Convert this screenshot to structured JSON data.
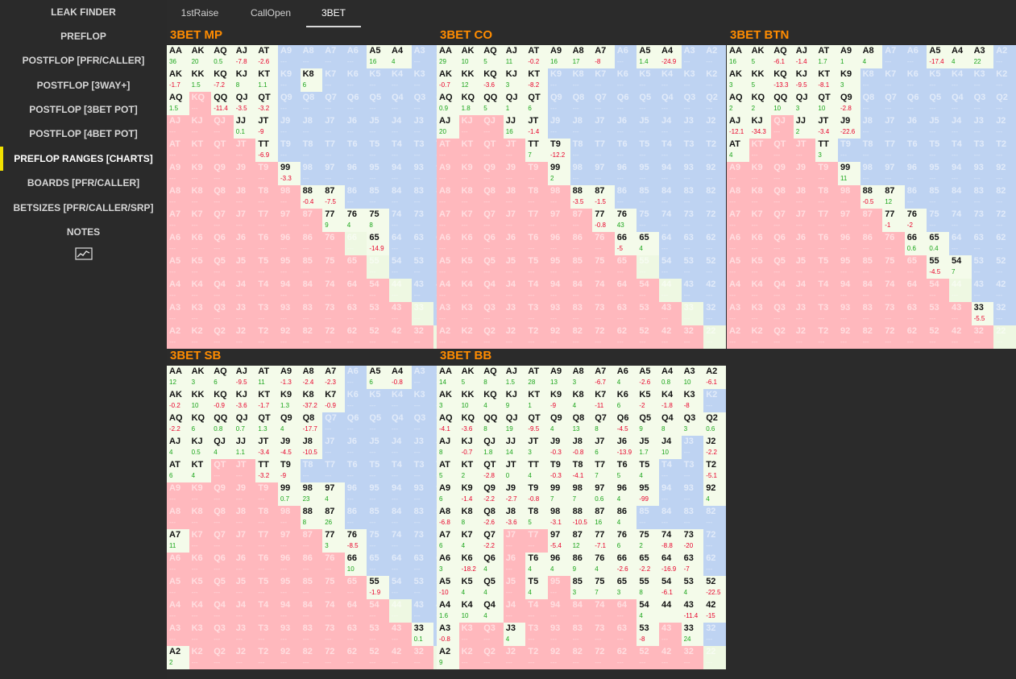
{
  "sidebar": {
    "items": [
      {
        "label": "LEAK FINDER",
        "name": "sidebar-item-leak-finder",
        "active": false
      },
      {
        "label": "PREFLOP",
        "name": "sidebar-item-preflop",
        "active": false
      },
      {
        "label": "POSTFLOP [PFR/CALLER]",
        "name": "sidebar-item-postflop-pfr-caller",
        "active": false
      },
      {
        "label": "POSTFLOP [3WAY+]",
        "name": "sidebar-item-postflop-3way",
        "active": false
      },
      {
        "label": "POSTFLOP [3BET POT]",
        "name": "sidebar-item-postflop-3bet-pot",
        "active": false
      },
      {
        "label": "POSTFLOP [4BET POT]",
        "name": "sidebar-item-postflop-4bet-pot",
        "active": false
      },
      {
        "label": "PREFLOP RANGES [CHARTS]",
        "name": "sidebar-item-preflop-ranges-charts",
        "active": true
      },
      {
        "label": "BOARDS [PFR/CALLER]",
        "name": "sidebar-item-boards-pfr-caller",
        "active": false
      },
      {
        "label": "BETSIZES [PFR/CALLER/SRP]",
        "name": "sidebar-item-betsizes",
        "active": false
      },
      {
        "label": "NOTES",
        "name": "sidebar-item-notes",
        "active": false
      }
    ],
    "chart_icon": "line-chart-icon"
  },
  "tabs": [
    {
      "label": "1stRaise",
      "active": false
    },
    {
      "label": "CallOpen",
      "active": false
    },
    {
      "label": "3BET",
      "active": true
    }
  ],
  "ranks": [
    "A",
    "K",
    "Q",
    "J",
    "T",
    "9",
    "8",
    "7",
    "6",
    "5",
    "4",
    "3",
    "2"
  ],
  "placeholder_value": "---",
  "colors": {
    "accent": "#ff8c00",
    "pair": "#eef8e2",
    "suited": "#bed3f2",
    "offsuit": "#ffb8bd",
    "active_cell": "#f4fbea",
    "positive": "#1aa51a",
    "negative": "#e8002a",
    "indicator": "#f0e000"
  },
  "panels": [
    {
      "title": "3BET MP",
      "cells": {
        "AA": "36",
        "AKs": "20",
        "AQs": "0.5",
        "AJs": "-7.8",
        "ATs": "-2.6",
        "A5s": "16",
        "A4s": "4",
        "AKo": "-1.7",
        "KK": "1.5",
        "KQs": "-7.2",
        "KJs": "8",
        "KTs": "1.1",
        "K8s": "6",
        "AQo": "1.5",
        "QQ": "-11.4",
        "QJs": "-3.5",
        "QTs": "-3.2",
        "JJ": "0.1",
        "JTs": "-9",
        "TT": "-6.9",
        "99": "-3.3",
        "88": "-0.4",
        "87s": "-7.5",
        "77": "9",
        "76s": "4",
        "75s": "8",
        "65s": "-14.9"
      }
    },
    {
      "title": "3BET CO",
      "cells": {
        "AA": "29",
        "AKs": "10",
        "AQs": "5",
        "AJs": "11",
        "ATs": "-0.2",
        "A9s": "16",
        "A8s": "17",
        "A7s": "-8",
        "A5s": "1.4",
        "A4s": "-24.9",
        "AKo": "-0.7",
        "KK": "12",
        "KQs": "-3.6",
        "KJs": "3",
        "KTs": "-8.2",
        "AQo": "0.9",
        "KQo": "1.8",
        "QQ": "5",
        "QJs": "1",
        "QTs": "6",
        "AJo": "20",
        "JJ": "16",
        "JTs": "-1.4",
        "TT": "7",
        "T9s": "-12.2",
        "99": "2",
        "88": "-3.5",
        "87s": "-1.5",
        "77": "-0.8",
        "76s": "43",
        "66": "-5",
        "65s": "4"
      }
    },
    {
      "title": "3BET BTN",
      "cells": {
        "AA": "16",
        "AKs": "5",
        "AQs": "-6.1",
        "AJs": "-1.4",
        "ATs": "1.7",
        "A9s": "1",
        "A8s": "4",
        "A5s": "-17.4",
        "A4s": "4",
        "A3s": "22",
        "AKo": "3",
        "KK": "5",
        "KQs": "-13.3",
        "KJs": "-9.5",
        "KTs": "-8.1",
        "K9s": "3",
        "AQo": "2",
        "KQo": "2",
        "QQ": "10",
        "QJs": "3",
        "QTs": "10",
        "Q9s": "-2.8",
        "AJo": "-12.1",
        "KJo": "-34.3",
        "JJ": "2",
        "JTs": "-3.4",
        "J9s": "-22.6",
        "ATo": "4",
        "TT": "3",
        "99": "11",
        "88": "-0.5",
        "87s": "12",
        "77": "-1",
        "76s": "-2",
        "66": "0.6",
        "65s": "0.4",
        "55": "-4.5",
        "54s": "7",
        "33": "-5.5"
      }
    },
    {
      "title": "3BET SB",
      "cells": {
        "AA": "12",
        "AKs": "3",
        "AQs": "6",
        "AJs": "-9.5",
        "ATs": "11",
        "A9s": "-1.3",
        "A8s": "-2.4",
        "A7s": "-2.3",
        "A5s": "6",
        "A4s": "-0.8",
        "AKo": "-0.2",
        "KK": "10",
        "KQs": "-0.9",
        "KJs": "-3.6",
        "KTs": "-1.7",
        "K9s": "1.3",
        "K8s": "-37.2",
        "K7s": "-0.9",
        "AQo": "-2.2",
        "KQo": "6",
        "QQ": "0.8",
        "QJs": "0.7",
        "QTs": "1.3",
        "Q9s": "4",
        "Q8s": "-17.7",
        "AJo": "4",
        "KJo": "0.5",
        "QJo": "4",
        "JJ": "1.1",
        "JTs": "-3.4",
        "J9s": "-4.5",
        "J8s": "-10.5",
        "ATo": "6",
        "KTo": "4",
        "TT": "-3.2",
        "T9s": "-9",
        "99": "0.7",
        "98s": "23",
        "97s": "4",
        "88": "8",
        "87s": "26",
        "A7o": "11",
        "77": "3",
        "76s": "-8.5",
        "66": "10",
        "55": "-1.9",
        "33": "0.1",
        "A2o": "2"
      }
    },
    {
      "title": "3BET BB",
      "cells": {
        "AA": "14",
        "AKs": "5",
        "AQs": "8",
        "AJs": "1.5",
        "ATs": "28",
        "A9s": "13",
        "A8s": "3",
        "A7s": "-6.7",
        "A6s": "4",
        "A5s": "-2.6",
        "A4s": "0.8",
        "A3s": "10",
        "A2s": "-6.1",
        "AKo": "3",
        "KK": "10",
        "KQs": "4",
        "KJs": "9",
        "KTs": "1",
        "K9s": "-9",
        "K8s": "4",
        "K7s": "-11",
        "K6s": "6",
        "K5s": "-2",
        "K4s": "-1.8",
        "K3s": "-8",
        "AQo": "-4.1",
        "KQo": "-3.6",
        "QQ": "8",
        "QJs": "19",
        "QTs": "-9.5",
        "Q9s": "4",
        "Q8s": "13",
        "Q7s": "8",
        "Q6s": "-4.5",
        "Q5s": "9",
        "Q4s": "8",
        "Q3s": "3",
        "Q2s": "0.6",
        "AJo": "8",
        "KJo": "-0.7",
        "QJo": "1.8",
        "JJ": "14",
        "JTs": "3",
        "J9s": "-0.3",
        "J8s": "-0.8",
        "J7s": "6",
        "J6s": "-13.9",
        "J5s": "1.7",
        "J4s": "10",
        "J2s": "-2.2",
        "ATo": "5",
        "KTo": "2",
        "QTo": "-2.8",
        "JTo": "0",
        "TT": "4",
        "T9s": "-0.3",
        "T8s": "-4.1",
        "T7s": "7",
        "T6s": "5",
        "T5s": "4",
        "T2s": "-5.1",
        "A9o": "6",
        "K9o": "-1.4",
        "Q9o": "-2.2",
        "J9o": "-2.7",
        "T9o": "-0.8",
        "99": "7",
        "98s": "7",
        "97s": "0.6",
        "96s": "4",
        "95s": "-99",
        "92s": "4",
        "A8o": "-6.8",
        "K8o": "8",
        "Q8o": "-2.6",
        "J8o": "-3.6",
        "T8o": "5",
        "98o": "-3.1",
        "88": "-10.5",
        "87s": "16",
        "86s": "4",
        "A7o": "6",
        "K7o": "4",
        "Q7o": "-2.2",
        "97o": "-5.4",
        "87o": "12",
        "77": "-7.1",
        "76s": "6",
        "75s": "2",
        "74s": "-8.8",
        "73s": "-20",
        "A6o": "3",
        "K6o": "-18.2",
        "Q6o": "4",
        "T6o": "4",
        "96o": "4",
        "86o": "9",
        "76o": "4",
        "66": "-2.6",
        "65s": "-2.2",
        "64s": "-16.9",
        "63s": "-7",
        "A5o": "-10",
        "K5o": "4",
        "Q5o": "4",
        "T5o": "4",
        "85o": "3",
        "75o": "7",
        "65o": "3",
        "55": "8",
        "54s": "-6.1",
        "53s": "4",
        "52s": "-22.5",
        "A4o": "1.6",
        "K4o": "10",
        "Q4o": "4",
        "54o": "4",
        "44": "",
        "43s": "-11.4",
        "42s": "-15",
        "A3o": "-0.8",
        "J3o": "4",
        "53o": "-8",
        "33": "24",
        "A2o": "9"
      }
    }
  ]
}
